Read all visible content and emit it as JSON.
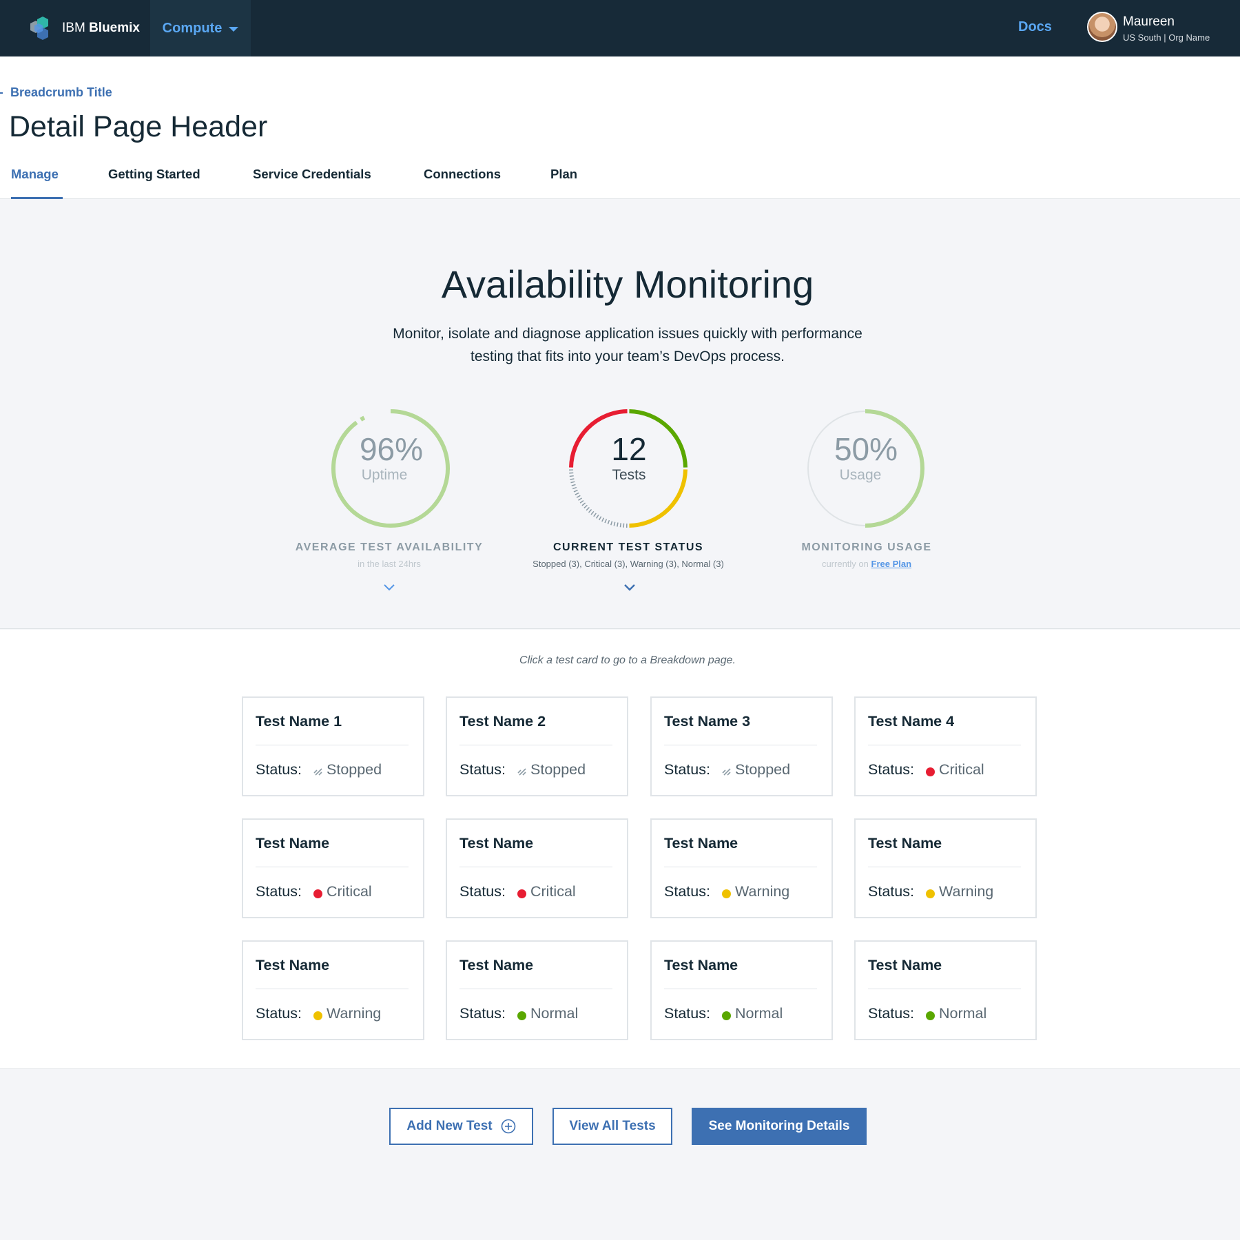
{
  "nav": {
    "brand_ibm": "IBM",
    "brand_product": "Bluemix",
    "compute_label": "Compute",
    "docs_label": "Docs",
    "user_name": "Maureen",
    "user_org": "US South | Org Name"
  },
  "header": {
    "breadcrumb": "Breadcrumb Title",
    "title": "Detail Page Header",
    "tabs": [
      "Manage",
      "Getting Started",
      "Service Credentials",
      "Connections",
      "Plan"
    ],
    "active_tab": "Manage"
  },
  "hero": {
    "title": "Availability Monitoring",
    "subtitle_line1": "Monitor, isolate and diagnose application issues quickly with performance",
    "subtitle_line2": "testing that fits into your team’s DevOps process.",
    "gauges": [
      {
        "value": "96%",
        "unit": "Uptime",
        "percent": 96,
        "label": "AVERAGE TEST AVAILABILITY",
        "note": "in the last 24hrs"
      },
      {
        "value": "12",
        "unit": "Tests",
        "label": "CURRENT TEST STATUS",
        "note": "Stopped (3), Critical (3), Warning (3), Normal (3)",
        "breakdown": {
          "Stopped": 3,
          "Critical": 3,
          "Warning": 3,
          "Normal": 3
        }
      },
      {
        "value": "50%",
        "unit": "Usage",
        "percent": 50,
        "label": "MONITORING USAGE",
        "note_prefix": "currently on",
        "note_link": "Free Plan"
      }
    ]
  },
  "cards_section": {
    "hint": "Click a test card to go to a Breakdown page.",
    "status_label": "Status:",
    "cards": [
      {
        "name": "Test Name 1",
        "status": "Stopped"
      },
      {
        "name": "Test Name 2",
        "status": "Stopped"
      },
      {
        "name": "Test Name 3",
        "status": "Stopped"
      },
      {
        "name": "Test Name 4",
        "status": "Critical"
      },
      {
        "name": "Test Name",
        "status": "Critical"
      },
      {
        "name": "Test Name",
        "status": "Critical"
      },
      {
        "name": "Test Name",
        "status": "Warning"
      },
      {
        "name": "Test Name",
        "status": "Warning"
      },
      {
        "name": "Test Name",
        "status": "Warning"
      },
      {
        "name": "Test Name",
        "status": "Normal"
      },
      {
        "name": "Test Name",
        "status": "Normal"
      },
      {
        "name": "Test Name",
        "status": "Normal"
      }
    ]
  },
  "actions": {
    "add_new_test": "Add New Test",
    "view_all_tests": "View All Tests",
    "see_monitoring_details": "See Monitoring Details"
  },
  "colors": {
    "nav_bg": "#172a38",
    "link_blue": "#3d70b2",
    "nav_link": "#5aa7f2",
    "critical": "#e71d32",
    "warning": "#efc100",
    "normal": "#5aa700",
    "uptime_ring": "#b4d896",
    "stopped": "#8c9ba5"
  }
}
